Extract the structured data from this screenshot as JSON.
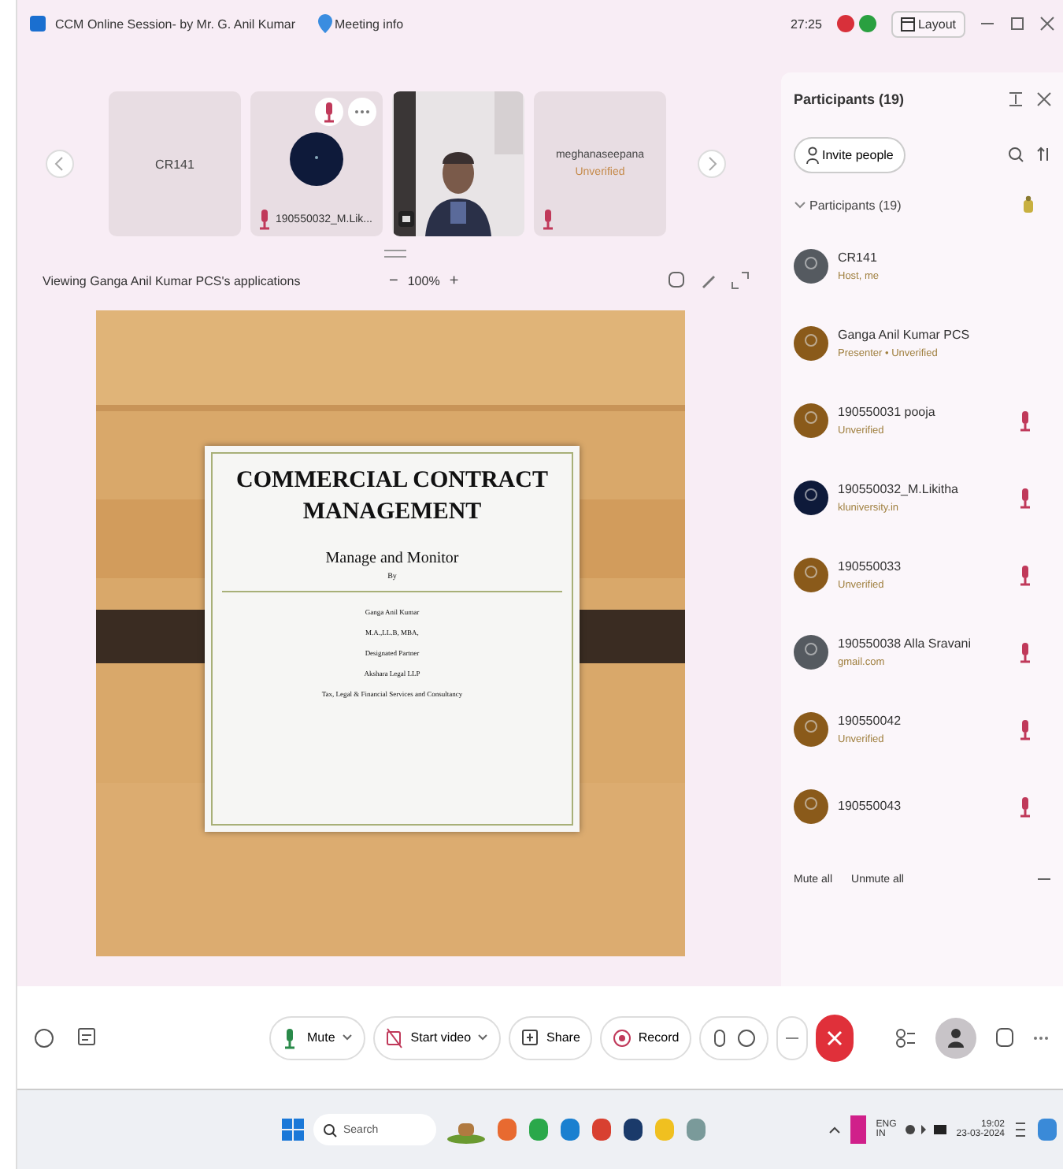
{
  "window": {
    "title": "CCM Online Session- by Mr. G. Anil Kumar",
    "meeting_info": "Meeting info",
    "time": "27:25",
    "layout_button": "Layout"
  },
  "filmstrip": [
    {
      "kind": "name",
      "name": "CR141"
    },
    {
      "kind": "avatar",
      "name": "190550032_M.Lik...",
      "muted": true
    },
    {
      "kind": "video"
    },
    {
      "kind": "status",
      "name": "meghanaseepana",
      "status": "Unverified",
      "muted": true
    }
  ],
  "share_bar": {
    "viewing": "Viewing Ganga Anil Kumar PCS's applications",
    "zoom": "100%",
    "minus": "−",
    "plus": "+"
  },
  "slide": {
    "title": "COMMERCIAL CONTRACT MANAGEMENT",
    "subtitle": "Manage and Monitor",
    "by": "By",
    "lines": [
      "Ganga Anil Kumar",
      "M.A.,LL.B, MBA,",
      "Designated Partner",
      "Akshara Legal LLP",
      "Tax, Legal & Financial Services and Consultancy"
    ]
  },
  "panel": {
    "title": "Participants (19)",
    "invite": "Invite people",
    "group": "Participants (19)",
    "expanded": true,
    "participants": [
      {
        "name": "CR141",
        "sub": "Host, me",
        "color": "#555a60",
        "muted": false
      },
      {
        "name": "Ganga Anil Kumar PCS",
        "sub": "Presenter • Unverified",
        "color": "#8a5a1a",
        "muted": false
      },
      {
        "name": "190550031 pooja",
        "sub": "Unverified",
        "color": "#8a5a1a",
        "muted": true
      },
      {
        "name": "190550032_M.Likitha",
        "sub": "kluniversity.in",
        "color": "#0e1a3a",
        "muted": true
      },
      {
        "name": "190550033",
        "sub": "Unverified",
        "color": "#8a5a1a",
        "muted": true
      },
      {
        "name": "190550038 Alla Sravani",
        "sub": "gmail.com",
        "color": "#555a60",
        "muted": true
      },
      {
        "name": "190550042",
        "sub": "Unverified",
        "color": "#8a5a1a",
        "muted": true
      },
      {
        "name": "190550043",
        "color": "#8a5a1a",
        "muted": true
      }
    ],
    "mute_all": "Mute all",
    "unmute_all": "Unmute all"
  },
  "controls": [
    {
      "kind": "mic",
      "label": "Mute"
    },
    {
      "kind": "video",
      "label": "Start video"
    },
    {
      "kind": "share",
      "label": "Share"
    },
    {
      "kind": "record",
      "label": "Record"
    }
  ],
  "taskbar": {
    "search": "Search",
    "lang": "ENG",
    "region": "IN",
    "time": "19:02",
    "date": "23-03-2024"
  }
}
